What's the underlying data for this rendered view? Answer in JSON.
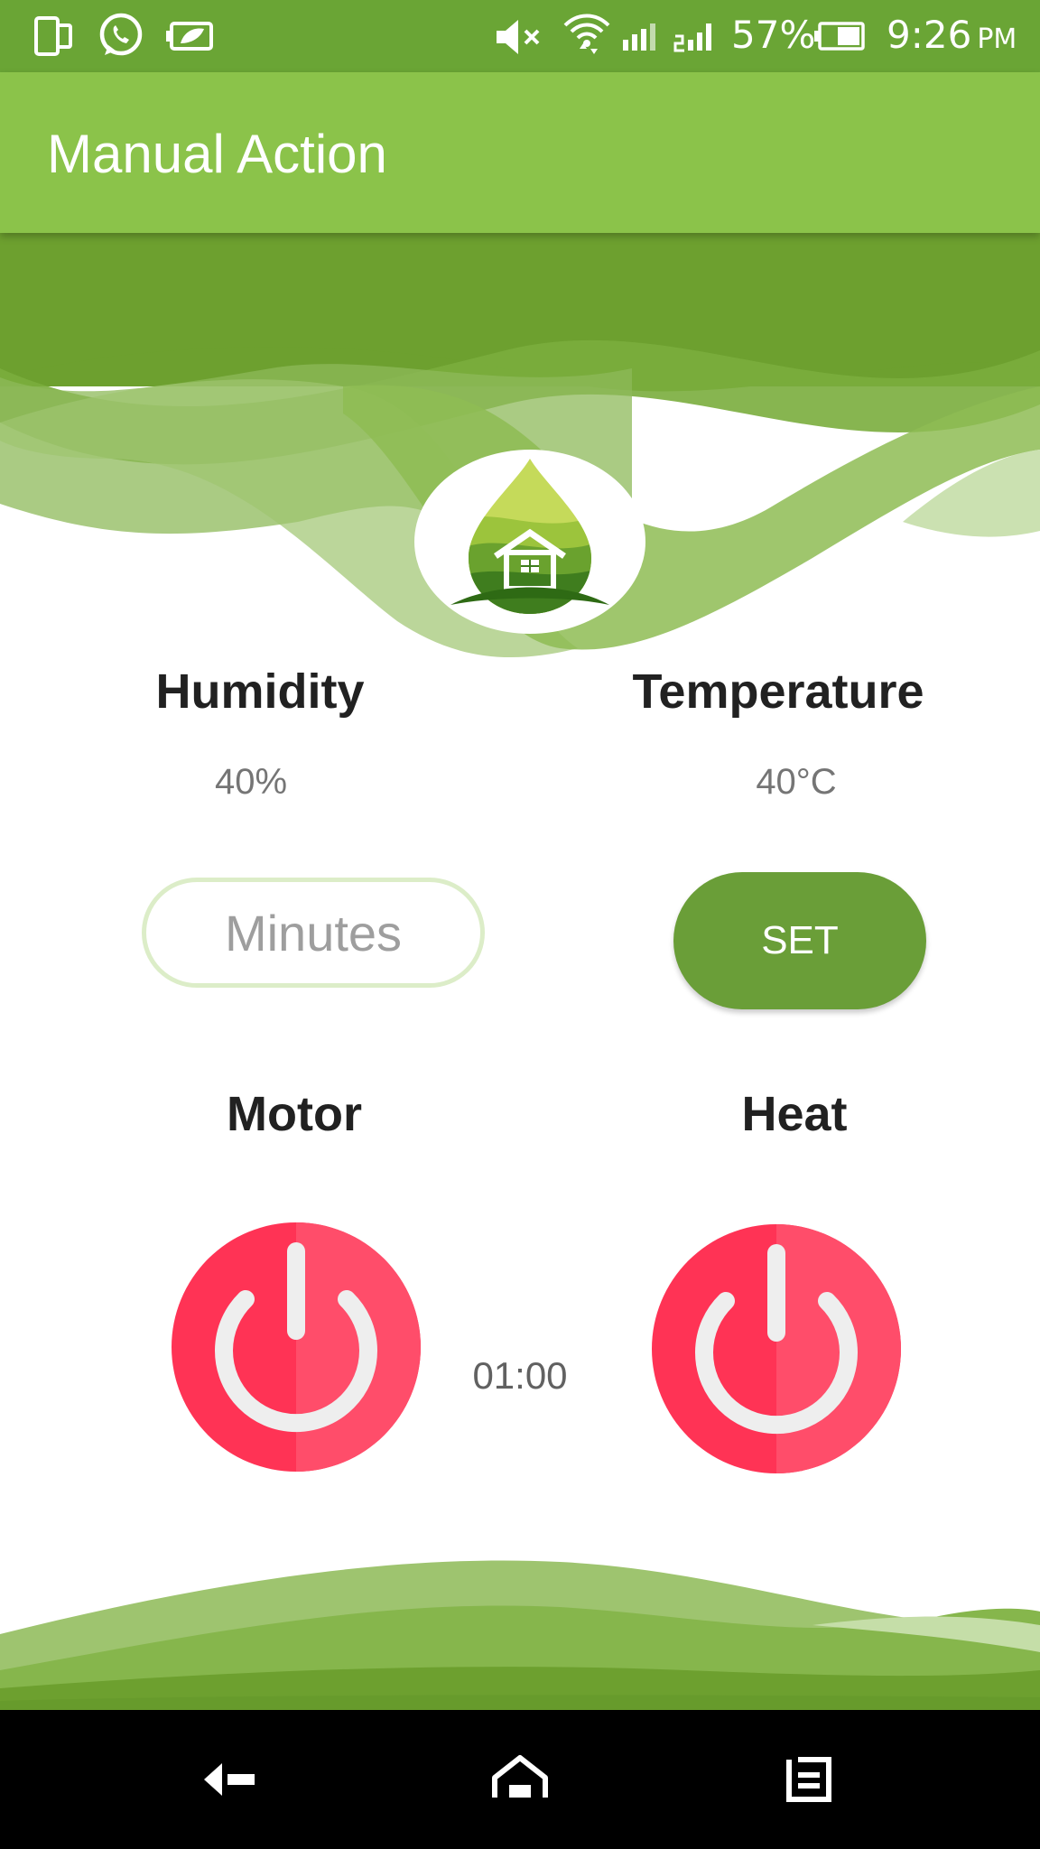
{
  "status_bar": {
    "battery_percent": "57%",
    "time": "9:26",
    "ampm": "PM",
    "icons": [
      "dual-screen-icon",
      "whatsapp-icon",
      "battery-saver-icon",
      "mute-icon",
      "wifi-icon",
      "signal-icon",
      "signal-2-icon",
      "battery-icon"
    ]
  },
  "app_bar": {
    "title": "Manual Action"
  },
  "sensors": {
    "humidity_label": "Humidity",
    "humidity_value": "40%",
    "temperature_label": "Temperature",
    "temperature_value": "40°C"
  },
  "timer": {
    "minutes_placeholder": "Minutes",
    "set_label": "SET",
    "countdown": "01:00"
  },
  "controls": {
    "motor_label": "Motor",
    "heat_label": "Heat"
  },
  "colors": {
    "status_bar": "#6aa535",
    "app_bar": "#8bc34a",
    "accent_green": "#6a9e38",
    "power_red": "#ff3355"
  },
  "nav_bar": {
    "icons": [
      "back-icon",
      "home-icon",
      "recents-icon"
    ]
  }
}
